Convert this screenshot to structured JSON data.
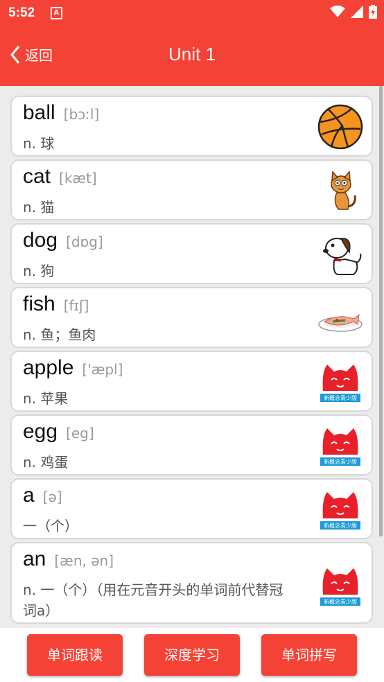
{
  "status": {
    "time": "5:52",
    "notif_icon": "A"
  },
  "header": {
    "back_label": "返回",
    "title": "Unit 1"
  },
  "words": [
    {
      "word": "ball",
      "phonetic": "[bɔːl]",
      "meaning": "n. 球",
      "image": "volleyball-icon"
    },
    {
      "word": "cat",
      "phonetic": "[kæt]",
      "meaning": "n. 猫",
      "image": "cat-icon"
    },
    {
      "word": "dog",
      "phonetic": "[dɒg]",
      "meaning": "n. 狗",
      "image": "dog-icon"
    },
    {
      "word": "fish",
      "phonetic": "[fɪʃ]",
      "meaning": "n. 鱼；鱼肉",
      "image": "fish-dish-icon"
    },
    {
      "word": "apple",
      "phonetic": "['æpl]",
      "meaning": "n. 苹果",
      "image": "logo-cat-icon"
    },
    {
      "word": "egg",
      "phonetic": "[eg]",
      "meaning": "n. 鸡蛋",
      "image": "logo-cat-icon"
    },
    {
      "word": "a",
      "phonetic": "[ə]",
      "meaning": "一（个）",
      "image": "logo-cat-icon"
    },
    {
      "word": "an",
      "phonetic": "[æn, ən]",
      "meaning": "n. 一（个）（用在元音开头的单词前代替冠词a）",
      "image": "logo-cat-icon"
    }
  ],
  "logo_text": "新概念青少版",
  "buttons": {
    "follow_read": "单词跟读",
    "deep_learn": "深度学习",
    "spelling": "单词拼写"
  },
  "colors": {
    "accent": "#f44336"
  }
}
